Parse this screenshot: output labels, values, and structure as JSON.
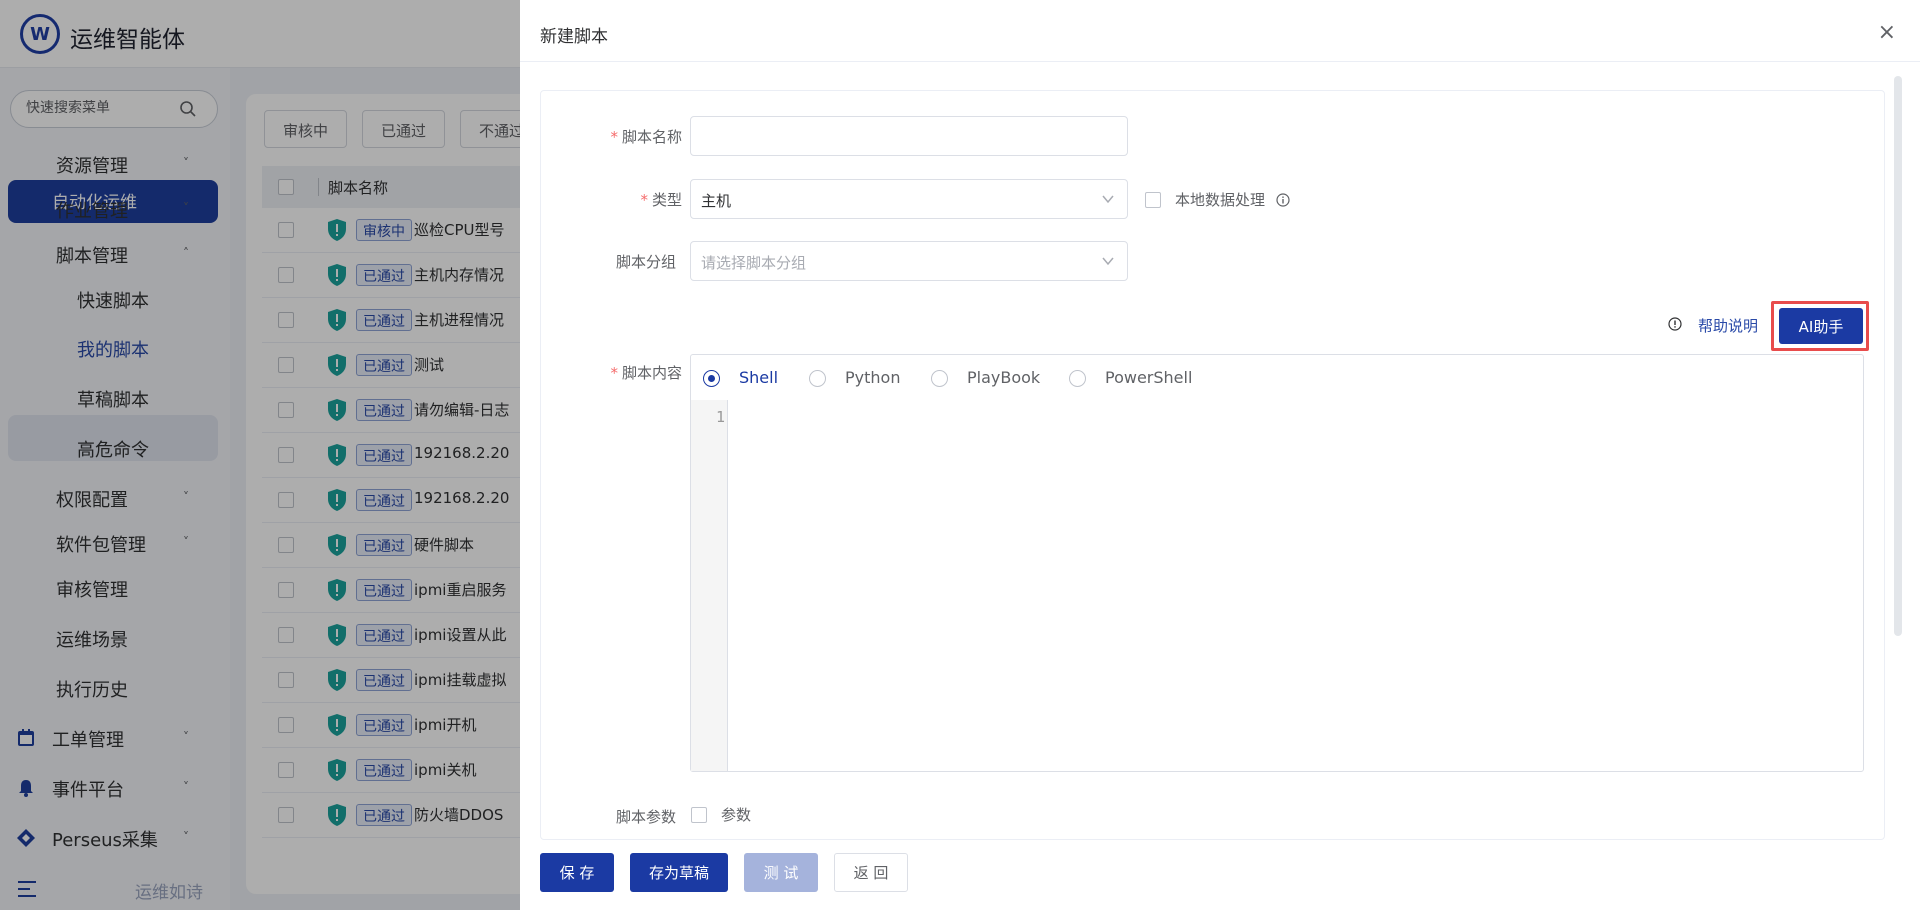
{
  "app": {
    "title": "运维智能体",
    "logo_text": "W",
    "footer_slogan": "运维如诗"
  },
  "sidebar": {
    "search_placeholder": "快速搜索菜单",
    "active_group": "自动化运维",
    "items": [
      {
        "label": "资源管理",
        "chevron": "˅"
      },
      {
        "label": "作业管理",
        "chevron": "˅"
      },
      {
        "label": "脚本管理",
        "chevron": "˄"
      },
      {
        "label": "快速脚本",
        "chevron": ""
      },
      {
        "label": "我的脚本",
        "chevron": ""
      },
      {
        "label": "草稿脚本",
        "chevron": ""
      },
      {
        "label": "高危命令",
        "chevron": ""
      },
      {
        "label": "权限配置",
        "chevron": "˅"
      },
      {
        "label": "软件包管理",
        "chevron": "˅"
      },
      {
        "label": "审核管理",
        "chevron": ""
      },
      {
        "label": "运维场景",
        "chevron": ""
      },
      {
        "label": "执行历史",
        "chevron": ""
      },
      {
        "label": "工单管理",
        "chevron": "˅"
      },
      {
        "label": "事件平台",
        "chevron": "˅"
      },
      {
        "label": "Perseus采集",
        "chevron": "˅"
      }
    ]
  },
  "bg_table": {
    "tabs": [
      "审核中",
      "已通过",
      "不通过"
    ],
    "header": "脚本名称",
    "rows": [
      {
        "badge": "审核中",
        "name": "巡检CPU型号"
      },
      {
        "badge": "已通过",
        "name": "主机内存情况"
      },
      {
        "badge": "已通过",
        "name": "主机进程情况"
      },
      {
        "badge": "已通过",
        "name": "测试"
      },
      {
        "badge": "已通过",
        "name": "请勿编辑-日志"
      },
      {
        "badge": "已通过",
        "name": "192168.2.20"
      },
      {
        "badge": "已通过",
        "name": "192168.2.20"
      },
      {
        "badge": "已通过",
        "name": "硬件脚本"
      },
      {
        "badge": "已通过",
        "name": "ipmi重启服务"
      },
      {
        "badge": "已通过",
        "name": "ipmi设置从此"
      },
      {
        "badge": "已通过",
        "name": "ipmi挂载虚拟"
      },
      {
        "badge": "已通过",
        "name": "ipmi开机"
      },
      {
        "badge": "已通过",
        "name": "ipmi关机"
      },
      {
        "badge": "已通过",
        "name": "防火墙DDOS"
      }
    ]
  },
  "drawer": {
    "title": "新建脚本",
    "close": "×",
    "form": {
      "name_label": "脚本名称",
      "name_value": "",
      "type_label": "类型",
      "type_value": "主机",
      "local_data_label": "本地数据处理",
      "group_label": "脚本分组",
      "group_placeholder": "请选择脚本分组",
      "help_label": "帮助说明",
      "ai_label": "AI助手",
      "content_label": "脚本内容",
      "languages": [
        "Shell",
        "Python",
        "PlayBook",
        "PowerShell"
      ],
      "selected_language": "Shell",
      "line_number": "1",
      "params_label": "脚本参数",
      "params_checkbox": "参数"
    },
    "buttons": {
      "save": "保 存",
      "draft": "存为草稿",
      "test": "测 试",
      "back": "返 回"
    }
  },
  "colors": {
    "primary": "#1b3aa3",
    "highlight": "#e84c4c",
    "required": "#f56c6c"
  }
}
